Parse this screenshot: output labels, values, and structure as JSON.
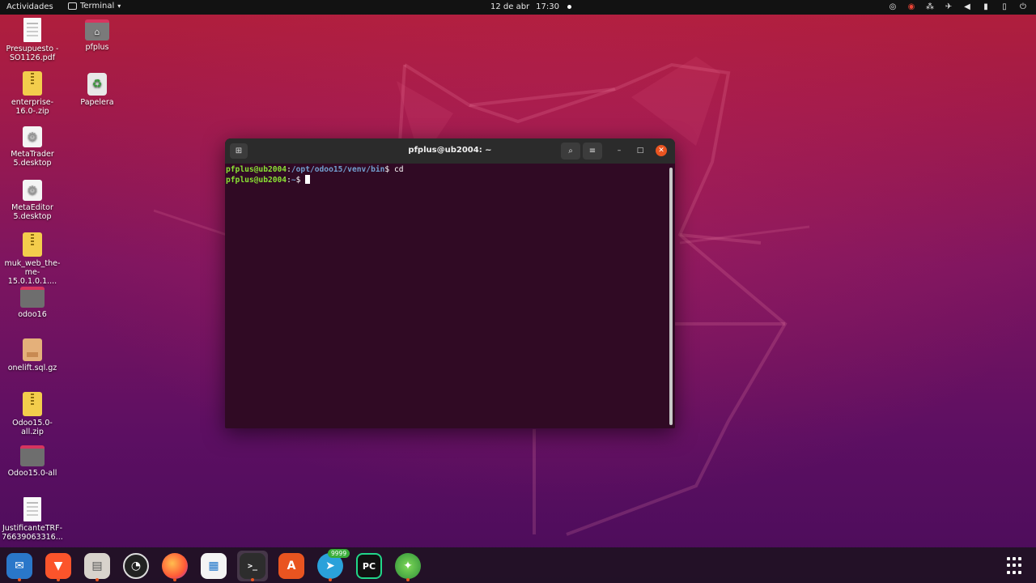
{
  "topbar": {
    "activities": "Actividades",
    "app_name": "Terminal",
    "date": "12 de abr",
    "time": "17:30",
    "tray_icons": [
      "chrome-icon",
      "chrome-icon",
      "network-icon",
      "airplane-mode-icon",
      "volume-icon",
      "microphone-icon",
      "battery-icon",
      "power-icon"
    ]
  },
  "desktop": {
    "icons": [
      {
        "label": "Presupuesto - SO1126.pdf",
        "type": "pdf"
      },
      {
        "label": "pfplus",
        "type": "home-folder"
      },
      {
        "label": "enterprise-16.0-.zip",
        "type": "zip"
      },
      {
        "label": "Papelera",
        "type": "trash"
      },
      {
        "label": "MetaTrader 5.desktop",
        "type": "desktop-file"
      },
      {
        "label": "MetaEditor 5.desktop",
        "type": "desktop-file"
      },
      {
        "label": "muk_web_the-me-15.0.1.0.1....",
        "type": "zip"
      },
      {
        "label": "odoo16",
        "type": "folder"
      },
      {
        "label": "onelift.sql.gz",
        "type": "archive"
      },
      {
        "label": "Odoo15.0-all.zip",
        "type": "zip"
      },
      {
        "label": "Odoo15.0-all",
        "type": "folder"
      },
      {
        "label": "JustificanteTRF-76639063316...",
        "type": "document"
      }
    ]
  },
  "terminal": {
    "title": "pfplus@ub2004: ~",
    "lines": [
      {
        "user_host": "pfplus@ub2004",
        "sep": ":",
        "path": "/opt/odoo15/venv/bin",
        "prompt": "$",
        "command": " cd"
      },
      {
        "user_host": "pfplus@ub2004",
        "sep": ":",
        "path": "~",
        "prompt": "$",
        "command": ""
      }
    ]
  },
  "dock": {
    "apps": [
      "thunderbird",
      "brave",
      "files",
      "obs-studio",
      "firefox",
      "libreoffice-writer",
      "terminal",
      "software-center",
      "telegram",
      "pycharm",
      "metatrader"
    ],
    "telegram_badge": "9999"
  }
}
